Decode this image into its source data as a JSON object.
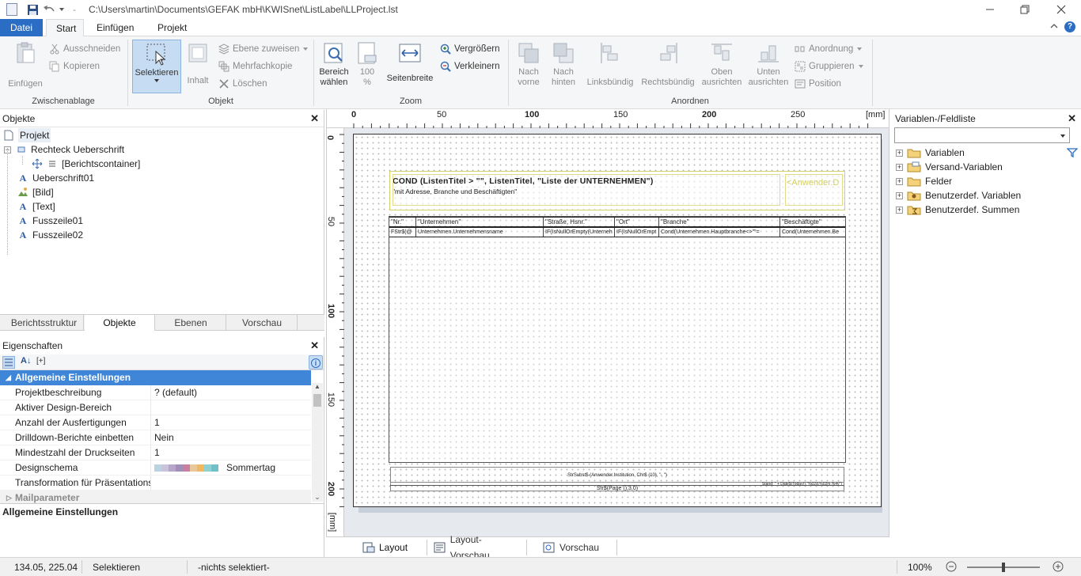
{
  "window": {
    "title": "C:\\Users\\martin\\Documents\\GEFAK mbH\\KWISnet\\ListLabel\\LLProject.lst",
    "minimize_icon": "minimize-icon",
    "restore_icon": "restore-icon",
    "close_icon": "close-icon"
  },
  "ribbon_tabs": [
    "Datei",
    "Start",
    "Einfügen",
    "Projekt"
  ],
  "ribbon": {
    "clipboard": {
      "paste": "Einfügen",
      "cut": "Ausschneiden",
      "copy": "Kopieren",
      "label": "Zwischenablage"
    },
    "object": {
      "select": "Selektieren",
      "content": "Inhalt",
      "assign_layer": "Ebene zuweisen",
      "multi_copy": "Mehrfachkopie",
      "delete": "Löschen",
      "label": "Objekt"
    },
    "zoom": {
      "select_area_1": "Bereich",
      "select_area_2": "wählen",
      "hundred_1": "100",
      "hundred_2": "%",
      "page_width": "Seitenbreite",
      "zoom_in": "Vergrößern",
      "zoom_out": "Verkleinern",
      "label": "Zoom"
    },
    "arrange": {
      "front_1": "Nach",
      "front_2": "vorne",
      "back_1": "Nach",
      "back_2": "hinten",
      "left_align": "Linksbündig",
      "right_align": "Rechtsbündig",
      "top_1": "Oben",
      "top_2": "ausrichten",
      "bottom_1": "Unten",
      "bottom_2": "ausrichten",
      "arrangement": "Anordnung",
      "group": "Gruppieren",
      "position": "Position",
      "label": "Anordnen"
    }
  },
  "objects_panel": {
    "title": "Objekte",
    "items": [
      {
        "label": "Projekt",
        "icon": "page-icon"
      },
      {
        "label": "Rechteck Ueberschrift",
        "icon": "rectangle-icon"
      },
      {
        "label": "[Berichtscontainer]",
        "icon": "container-icon"
      },
      {
        "label": "Ueberschrift01",
        "icon": "text-icon"
      },
      {
        "label": "[Bild]",
        "icon": "image-icon"
      },
      {
        "label": "[Text]",
        "icon": "text-icon"
      },
      {
        "label": "Fusszeile01",
        "icon": "text-icon"
      },
      {
        "label": "Fusszeile02",
        "icon": "text-icon"
      }
    ],
    "tabs": [
      "Berichtsstruktur",
      "Objekte",
      "Ebenen",
      "Vorschau"
    ]
  },
  "properties_panel": {
    "title": "Eigenschaften",
    "group_general": "Allgemeine Einstellungen",
    "rows": [
      {
        "key": "Projektbeschreibung",
        "value": "? (default)"
      },
      {
        "key": "Aktiver Design-Bereich",
        "value": ""
      },
      {
        "key": "Anzahl der Ausfertigungen",
        "value": "1"
      },
      {
        "key": "Drilldown-Berichte einbetten",
        "value": "Nein"
      },
      {
        "key": "Mindestzahl der Druckseiten",
        "value": "1"
      },
      {
        "key": "Designschema",
        "value": "Sommertag"
      },
      {
        "key": "Transformation für Präsentations...",
        "value": ""
      }
    ],
    "group_mail": "Mailparameter",
    "footer": "Allgemeine Einstellungen",
    "scheme_colors": [
      "#b9d3e0",
      "#c9c3dc",
      "#b7a6cc",
      "#a28fb8",
      "#c97fa0",
      "#e8c89a",
      "#f0b860",
      "#8fd1d3",
      "#6fc0c8"
    ]
  },
  "design": {
    "ruler_unit": "[mm]",
    "h_ticks": [
      "0",
      "50",
      "100",
      "150",
      "200",
      "250"
    ],
    "v_ticks": [
      "0",
      "50",
      "100",
      "150",
      "200"
    ],
    "header_formula": "COND (ListenTitel > \"\", ListenTitel, \"Liste der UNTERNEHMEN\")",
    "header_sub": "\"mit Adresse, Branche und Beschäftigten\"",
    "user_field": "<Anwender.D",
    "table_headers": [
      "\"Nr.\"",
      "\"Unternehmen\"",
      "\"Straße, Hsnr.\"",
      "\"Ort\"",
      "\"Branche\"",
      "\"Beschäftigte\""
    ],
    "table_cells": [
      "FStr$(@",
      "Unternehmen.Unternehmensname",
      "IF(IsNullOrEmpty(Unterneh",
      "IF(IsNullOrEmpt",
      "Cond(Unternehmen.Hauptbranche<>\"\"=",
      "Cond(Unternehmen.Be"
    ],
    "footer1": "StrSubst$ (Anwender.Institution, Chr$ (10), \", \")",
    "footer2_right": "Stand: \" + Date$(Today(),\"%02d.%02m.%4y\")",
    "footer3": "Str$(Page (),3,0)"
  },
  "bottom_tabs": [
    "Layout",
    "Layout-Vorschau",
    "Vorschau"
  ],
  "vars_panel": {
    "title": "Variablen-/Feldliste",
    "search_value": "",
    "items": [
      "Variablen",
      "Versand-Variablen",
      "Felder",
      "Benutzerdef. Variablen",
      "Benutzerdef. Summen"
    ]
  },
  "status": {
    "coords": "134.05, 225.04",
    "mode": "Selektieren",
    "selection": "-nichts selektiert-",
    "zoom": "100%",
    "zoom_level": 0.5
  }
}
